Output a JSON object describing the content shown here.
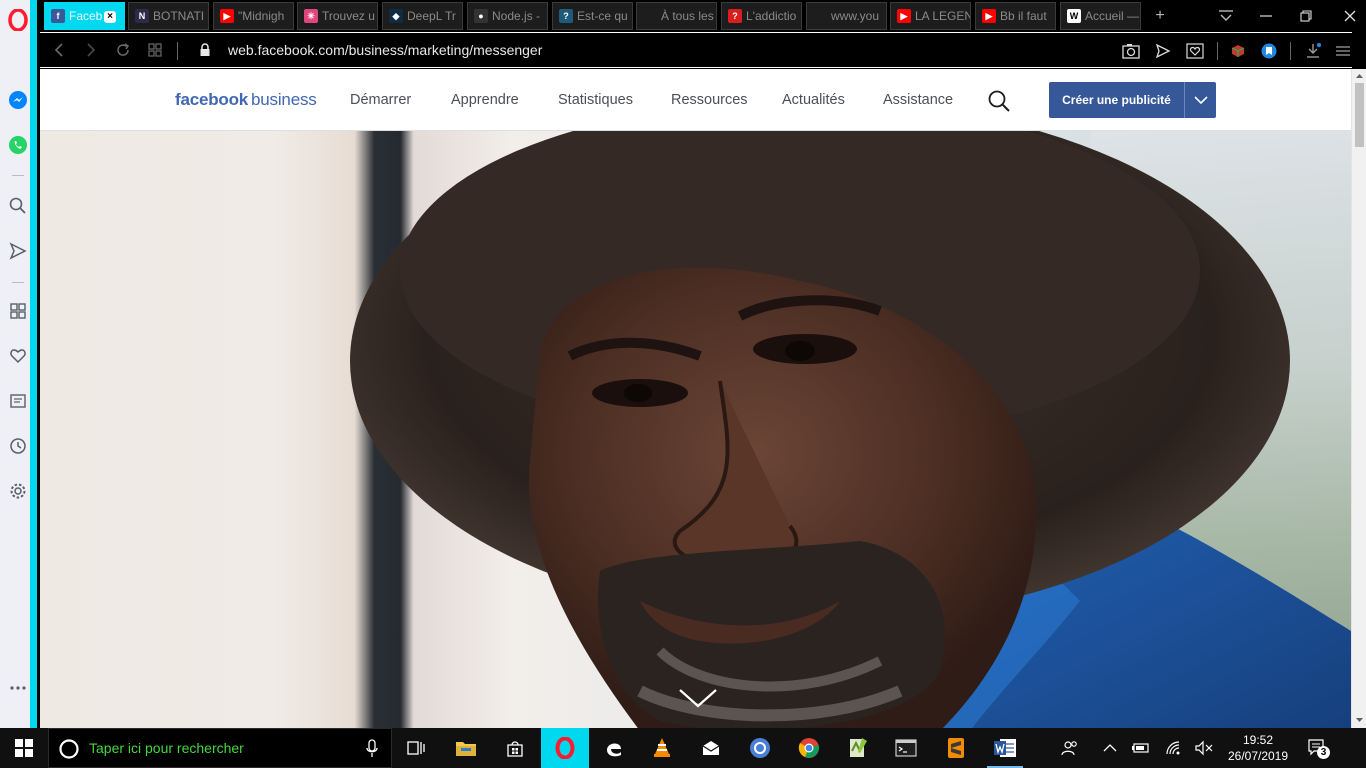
{
  "browser": {
    "tabs": [
      {
        "title": "Faceb",
        "favicon": "facebook-icon",
        "color": "#3b5998",
        "glyph": "f",
        "active": true
      },
      {
        "title": "BOTNATI",
        "favicon": "botnation-icon",
        "color": "#2c2c4a",
        "glyph": "N"
      },
      {
        "title": "\"Midnigh",
        "favicon": "youtube-icon",
        "color": "#ff0000",
        "glyph": "▶"
      },
      {
        "title": "Trouvez u",
        "favicon": "puzzle-icon",
        "color": "#e0457b",
        "glyph": "✳"
      },
      {
        "title": "DeepL Tr",
        "favicon": "deepl-icon",
        "color": "#0f2b46",
        "glyph": "◆"
      },
      {
        "title": "Node.js -",
        "favicon": "github-icon",
        "color": "#333333",
        "glyph": "●"
      },
      {
        "title": "Est-ce qu",
        "favicon": "stackexchange-icon",
        "color": "#1e5a7a",
        "glyph": "?"
      },
      {
        "title": "À tous les",
        "favicon": "blank-icon",
        "color": "#1d1d1d",
        "glyph": ""
      },
      {
        "title": "L'addictio",
        "favicon": "quora-icon",
        "color": "#d81e1e",
        "glyph": "?"
      },
      {
        "title": "www.you",
        "favicon": "blank-icon",
        "color": "#1d1d1d",
        "glyph": ""
      },
      {
        "title": "LA LEGEN",
        "favicon": "youtube-icon",
        "color": "#ff0000",
        "glyph": "▶"
      },
      {
        "title": "Bb il faut",
        "favicon": "youtube-icon",
        "color": "#ff0000",
        "glyph": "▶"
      },
      {
        "title": "Accueil —",
        "favicon": "wikipedia-icon",
        "color": "#ffffff",
        "glyph": "W"
      }
    ],
    "url": "web.facebook.com/business/marketing/messenger"
  },
  "fb": {
    "logo_bold": "facebook",
    "logo_light": "business",
    "nav": [
      {
        "id": "demarrer",
        "label": "Démarrer"
      },
      {
        "id": "apprendre",
        "label": "Apprendre"
      },
      {
        "id": "statistiques",
        "label": "Statistiques"
      },
      {
        "id": "ressources",
        "label": "Ressources"
      },
      {
        "id": "actualites",
        "label": "Actualités"
      },
      {
        "id": "assistance",
        "label": "Assistance"
      }
    ],
    "cta_label": "Créer une publicité",
    "brand_color": "#4267b2"
  },
  "taskbar": {
    "search_placeholder": "Taper ici pour rechercher",
    "time": "19:52",
    "date": "26/07/2019",
    "notifications": "3"
  },
  "colors": {
    "opera_accent": "#00d8f0",
    "cta_bg": "#365899",
    "search_text": "#44d640"
  }
}
